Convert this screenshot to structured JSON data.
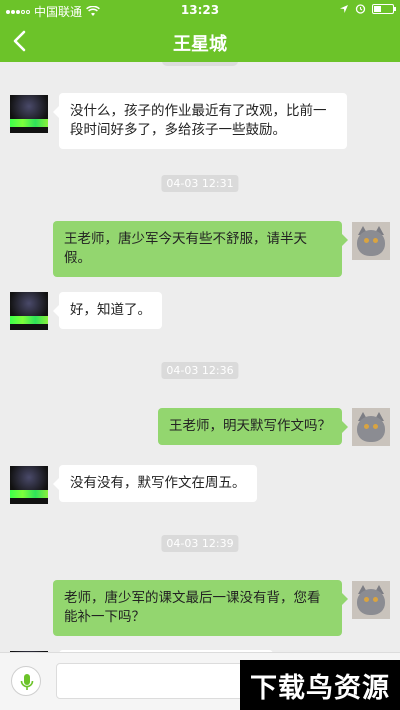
{
  "status_bar": {
    "carrier": "中国联通",
    "time": "13:23"
  },
  "header": {
    "title": "王星城"
  },
  "messages": [
    {
      "side": "in",
      "text": "没什么，孩子的作业最近有了改观，比前一段时间好多了，多给孩子一些鼓励。"
    },
    {
      "timestamp": "04-03 12:31"
    },
    {
      "side": "out",
      "text": "王老师，唐少军今天有些不舒服，请半天假。"
    },
    {
      "side": "in",
      "text": "好，知道了。"
    },
    {
      "timestamp": "04-03 12:36"
    },
    {
      "side": "out",
      "text": "王老师，明天默写作文吗？"
    },
    {
      "side": "in",
      "text": "没有没有，默写作文在周五。"
    },
    {
      "timestamp": "04-03 12:39"
    },
    {
      "side": "out",
      "text": "老师，唐少军的课文最后一课没有背，您看能补一下吗？"
    }
  ],
  "input": {
    "placeholder": ""
  },
  "watermark": {
    "text": "下载鸟资源"
  },
  "colors": {
    "brand": "#6cc329",
    "outgoing_bubble": "#93d66f",
    "incoming_bubble": "#ffffff",
    "background": "#ededed"
  }
}
